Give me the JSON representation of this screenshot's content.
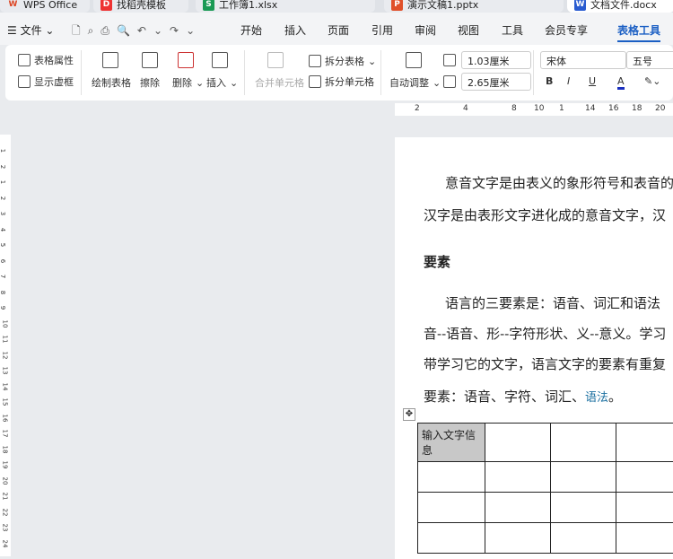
{
  "tabs": [
    "WPS Office",
    "找稻壳模板",
    "工作簿1.xlsx",
    "演示文稿1.pptx",
    "文档文件.docx"
  ],
  "menu": {
    "file": "文件",
    "items": [
      "开始",
      "插入",
      "页面",
      "引用",
      "审阅",
      "视图",
      "工具",
      "会员专享",
      "表格工具"
    ]
  },
  "ribbon": {
    "table_props": "表格属性",
    "show_gridlines": "显示虚框",
    "draw_table": "绘制表格",
    "erase": "擦除",
    "delete": "删除",
    "insert": "插入",
    "merge_cells": "合并单元格",
    "split_table": "拆分表格",
    "split_cells": "拆分单元格",
    "auto_fit": "自动调整",
    "row_height": "1.03厘米",
    "col_width": "2.65厘米",
    "font": "宋体",
    "font_size": "五号",
    "bold": "B",
    "italic": "I",
    "underline": "U",
    "font_color": "A"
  },
  "ruler_h": [
    "2",
    "4",
    "8",
    "10",
    "1",
    "14",
    "16",
    "18",
    "20"
  ],
  "ruler_v": [
    "1",
    "2",
    "1",
    "2",
    "3",
    "4",
    "5",
    "6",
    "7",
    "8",
    "9",
    "10",
    "11",
    "12",
    "13",
    "14",
    "15",
    "16",
    "17",
    "18",
    "19",
    "20",
    "21",
    "22",
    "23",
    "24"
  ],
  "doc": {
    "line1": "意音文字是由表义的象形符号和表音的",
    "line2": "汉字是由表形文字进化成的意音文字，汉",
    "heading": "要素",
    "line3": "语言的三要素是：语音、词汇和语法",
    "line4": "音--语音、形--字符形状、义--意义。学习",
    "line5": "带学习它的文字，语言文字的要素有重复",
    "line6a": "要素：语音、字符、词汇、",
    "line6b": "语法",
    "line6c": "。",
    "cell": "输入文字信息"
  }
}
